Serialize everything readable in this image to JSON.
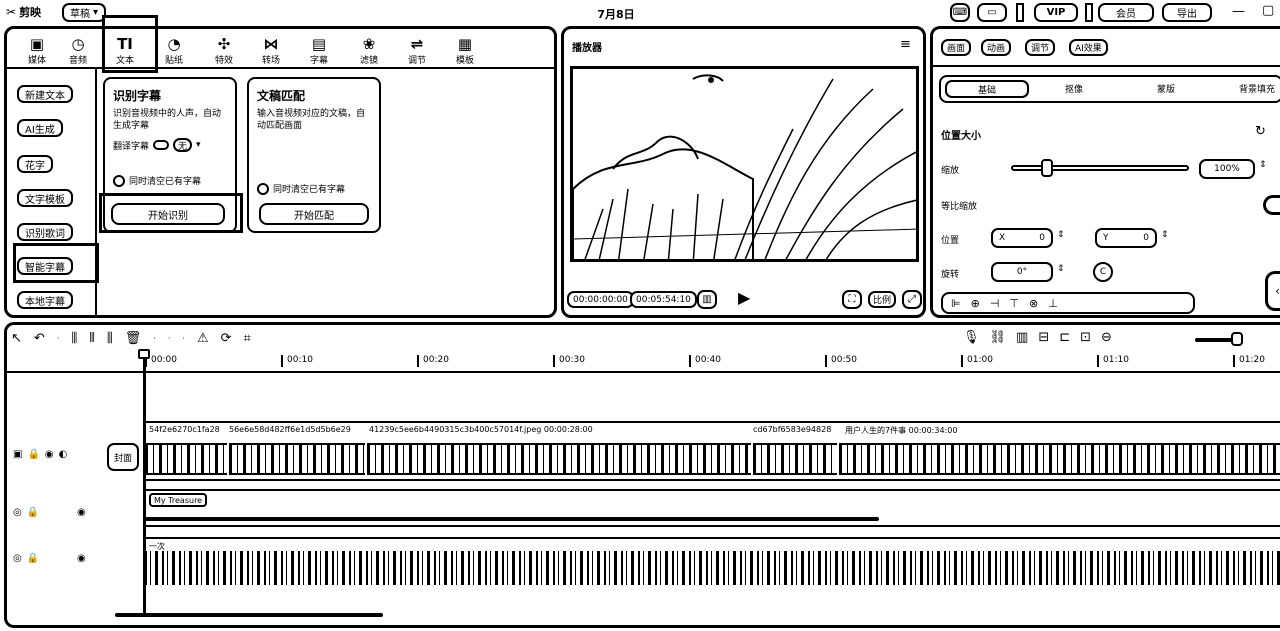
{
  "app": {
    "name": "剪映",
    "draft_label": "草稿",
    "date": "7月8日"
  },
  "topbar_right": [
    "快捷键",
    "VIP",
    "会员",
    "导出"
  ],
  "media_tabs": [
    {
      "label": "媒体",
      "glyph": "▣"
    },
    {
      "label": "音频",
      "glyph": "◷"
    },
    {
      "label": "文本",
      "glyph": "TI"
    },
    {
      "label": "贴纸",
      "glyph": "◔"
    },
    {
      "label": "特效",
      "glyph": "✣"
    },
    {
      "label": "转场",
      "glyph": "⋈"
    },
    {
      "label": "字幕",
      "glyph": "▤"
    },
    {
      "label": "滤镜",
      "glyph": "❀"
    },
    {
      "label": "调节",
      "glyph": "⇌"
    },
    {
      "label": "模板",
      "glyph": "▦"
    }
  ],
  "sidebar": [
    "新建文本",
    "AI生成",
    "花字",
    "文字模板",
    "识别歌词",
    "智能字幕",
    "本地字幕"
  ],
  "cards": [
    {
      "title": "识别字幕",
      "desc": "识别音视频中的人声，自动生成字幕",
      "translate": "翻译字幕",
      "translate_value": "无",
      "checkbox": "同时清空已有字幕",
      "button": "开始识别"
    },
    {
      "title": "文稿匹配",
      "desc": "输入音视频对应的文稿，自动匹配画面",
      "checkbox": "同时清空已有字幕",
      "button": "开始匹配"
    }
  ],
  "player": {
    "title": "播放器",
    "current_time": "00:00:00:00",
    "total_time": "00:05:54:10",
    "ratio_label": "比例"
  },
  "attr": {
    "tabs": [
      "画面",
      "动画",
      "调节",
      "AI效果"
    ],
    "subtabs": [
      "基础",
      "抠像",
      "蒙版",
      "背景填充"
    ],
    "position_size": "位置大小",
    "scale_label": "缩放",
    "scale_value": "100%",
    "uniform_scale": "等比缩放",
    "position_label": "位置",
    "x_label": "X",
    "x_value": "0",
    "y_label": "Y",
    "y_value": "0",
    "rotate_label": "旋转",
    "rotate_value": "0°"
  },
  "timeline": {
    "ruler": [
      "00:00",
      "00:10",
      "00:20",
      "00:30",
      "00:40",
      "00:50",
      "01:00",
      "01:10",
      "01:20"
    ],
    "cover_label": "封面",
    "clips": [
      {
        "label": "54f2e6270c1fa28"
      },
      {
        "label": "56e6e58d482ff6e1d5d5b6e29"
      },
      {
        "label": "41239c5ee6b4490315c3b400c57014f.jpeg  00:00:28:00"
      },
      {
        "label": "cd67bf6583e94828"
      },
      {
        "label": "用户人生的7件事  00:00:34:00"
      }
    ],
    "text_clip": "My Treasure",
    "audio_clip": "一次"
  }
}
